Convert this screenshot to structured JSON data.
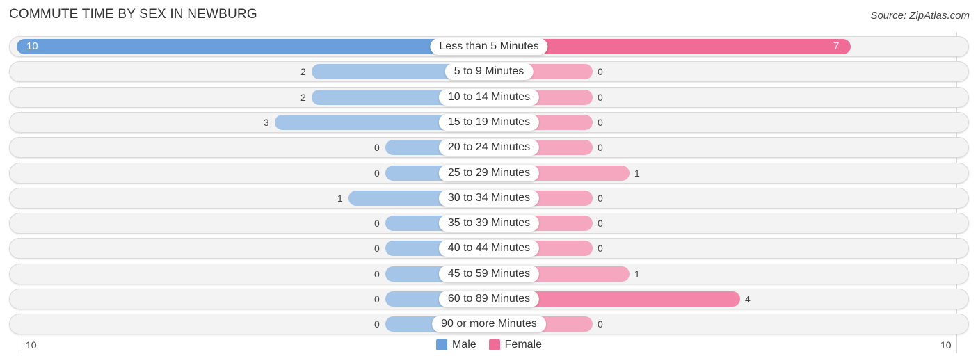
{
  "title": "COMMUTE TIME BY SEX IN NEWBURG",
  "source": "Source: ZipAtlas.com",
  "colors": {
    "male_strong": "#6a9fdc",
    "male_light": "#a5c5e8",
    "female_strong": "#f06b96",
    "female_light": "#f6a7c0"
  },
  "chart_data": {
    "type": "bar",
    "orientation": "horizontal-diverging",
    "title": "COMMUTE TIME BY SEX IN NEWBURG",
    "categories": [
      "Less than 5 Minutes",
      "5 to 9 Minutes",
      "10 to 14 Minutes",
      "15 to 19 Minutes",
      "20 to 24 Minutes",
      "25 to 29 Minutes",
      "30 to 34 Minutes",
      "35 to 39 Minutes",
      "40 to 44 Minutes",
      "45 to 59 Minutes",
      "60 to 89 Minutes",
      "90 or more Minutes"
    ],
    "series": [
      {
        "name": "Male",
        "values": [
          10,
          2,
          2,
          3,
          0,
          0,
          1,
          0,
          0,
          0,
          0,
          0
        ]
      },
      {
        "name": "Female",
        "values": [
          7,
          0,
          0,
          0,
          0,
          1,
          0,
          0,
          0,
          1,
          4,
          0
        ]
      }
    ],
    "axis": {
      "left_tick": "10",
      "right_tick": "10",
      "max": 10
    },
    "legend": {
      "position": "bottom-center",
      "entries": [
        "Male",
        "Female"
      ]
    }
  }
}
